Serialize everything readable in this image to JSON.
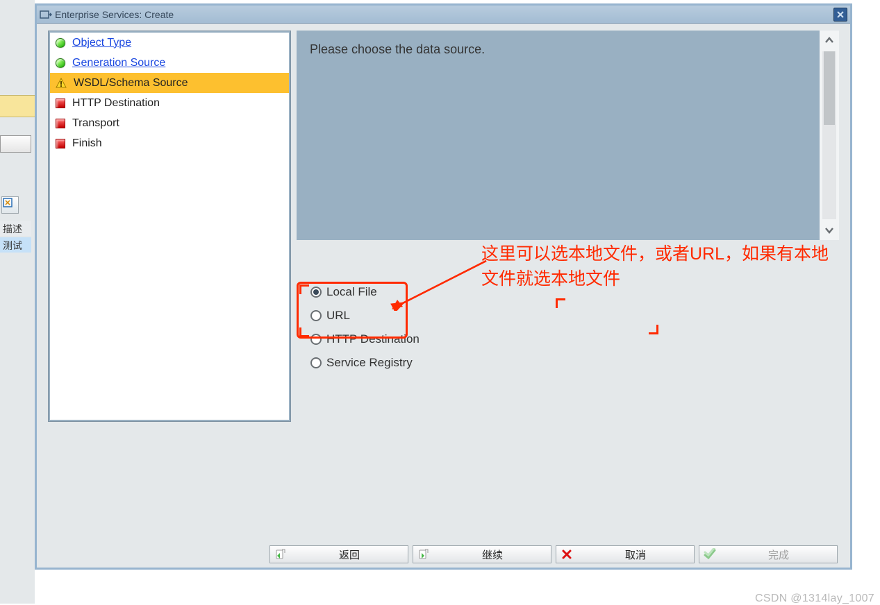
{
  "window": {
    "title": "Enterprise Services: Create"
  },
  "sidebar_bg": {
    "label_desc": "描述",
    "label_test": "测试"
  },
  "steps": [
    {
      "label": "Object Type",
      "done": true,
      "active": false,
      "link": true
    },
    {
      "label": "Generation Source",
      "done": true,
      "active": false,
      "link": true
    },
    {
      "label": "WSDL/Schema Source",
      "done": false,
      "active": true,
      "link": false,
      "warn": true
    },
    {
      "label": "HTTP Destination",
      "done": false,
      "active": false,
      "link": false,
      "pend": true
    },
    {
      "label": "Transport",
      "done": false,
      "active": false,
      "link": false,
      "pend": true
    },
    {
      "label": "Finish",
      "done": false,
      "active": false,
      "link": false,
      "pend": true
    }
  ],
  "content": {
    "prompt": "Please choose the data source."
  },
  "options": [
    {
      "label": "Local File",
      "selected": true
    },
    {
      "label": "URL",
      "selected": false
    },
    {
      "label": "HTTP Destination",
      "selected": false
    },
    {
      "label": "Service Registry",
      "selected": false
    }
  ],
  "annotation": {
    "text": "这里可以选本地文件，或者URL，如果有本地文件就选本地文件"
  },
  "buttons": {
    "back": "返回",
    "next": "继续",
    "cancel": "取消",
    "finish": "完成"
  },
  "watermark": "CSDN @1314lay_1007"
}
